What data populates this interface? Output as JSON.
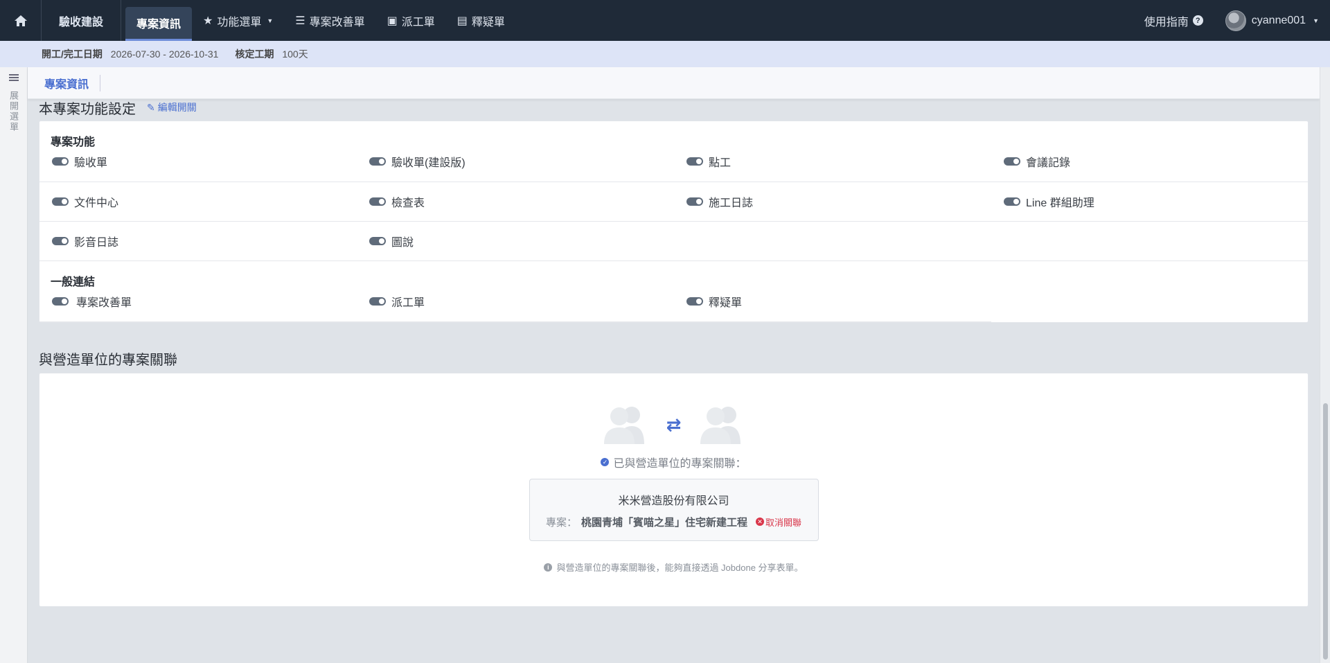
{
  "topbar": {
    "brand": "驗收建設",
    "nav": [
      {
        "label": "專案資訊",
        "icon": "none",
        "active": true
      },
      {
        "label": "功能選單",
        "icon": "star-icon",
        "dropdown": true
      },
      {
        "label": "專案改善單",
        "icon": "checklist-icon"
      },
      {
        "label": "派工單",
        "icon": "badge-icon"
      },
      {
        "label": "釋疑單",
        "icon": "chat-icon"
      }
    ],
    "help": "使用指南",
    "username": "cyanne001"
  },
  "infobar": {
    "period_label": "開工/完工日期",
    "period_value": "2026-07-30 - 2026-10-31",
    "days_label": "核定工期",
    "days_value": "100天"
  },
  "leftrail": {
    "label": "展開選單"
  },
  "tabstrip": {
    "tab": "專案資訊"
  },
  "features": {
    "title": "本專案功能設定",
    "edit_label": "編輯開關",
    "group1_title": "專案功能",
    "group1": [
      [
        "驗收單",
        "驗收單(建設版)",
        "點工",
        "會議記錄"
      ],
      [
        "文件中心",
        "檢查表",
        "施工日誌",
        "Line 群組助理"
      ],
      [
        "影音日誌",
        "圖說"
      ]
    ],
    "group2_title": "一般連結",
    "group2": [
      "專案改善單",
      "派工單",
      "釋疑單"
    ]
  },
  "association": {
    "title": "與營造單位的專案關聯",
    "linked_text": "已與營造單位的專案關聯：",
    "company": "米米營造股份有限公司",
    "project_prefix": "專案：",
    "project_name": "桃園青埔「賓喵之星」住宅新建工程",
    "unlink_label": "取消關聯",
    "note": "與營造單位的專案關聯後，能夠直接透過 Jobdone 分享表單。",
    "arrows": "⇄"
  }
}
